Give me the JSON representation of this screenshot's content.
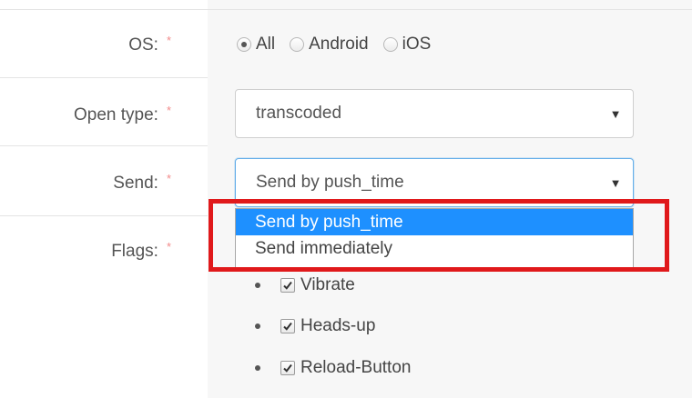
{
  "labels": {
    "os": "OS:",
    "open_type": "Open type:",
    "send": "Send:",
    "flags": "Flags:",
    "required_mark": "*"
  },
  "os_options": [
    {
      "label": "All",
      "selected": true
    },
    {
      "label": "Android",
      "selected": false
    },
    {
      "label": "iOS",
      "selected": false
    }
  ],
  "open_type_select": {
    "value": "transcoded",
    "arrow_icon": "triangle-down-icon"
  },
  "send_select": {
    "value": "Send by push_time",
    "arrow_icon": "triangle-down-icon",
    "options": [
      {
        "label": "Send by push_time",
        "highlighted": true
      },
      {
        "label": "Send immediately",
        "highlighted": false
      }
    ]
  },
  "flags": [
    {
      "label": "Vibrate",
      "checked": true
    },
    {
      "label": "Heads-up",
      "checked": true
    },
    {
      "label": "Reload-Button",
      "checked": true
    }
  ],
  "colors": {
    "required_star": "#f28a8a",
    "option_highlight": "#1e90ff",
    "annotation_box": "#e0191b",
    "field_background": "#f7f7f7"
  }
}
